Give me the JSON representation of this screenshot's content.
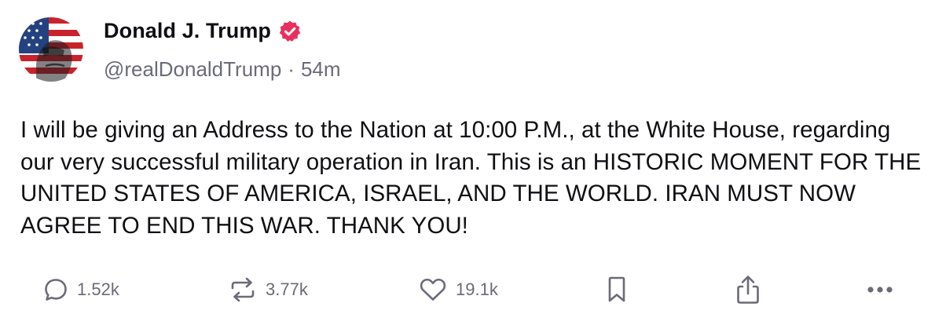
{
  "author": {
    "display_name": "Donald J. Trump",
    "handle": "@realDonaldTrump",
    "separator": "·",
    "time_ago": "54m",
    "verified": true,
    "avatar": "avatar-flag-portrait"
  },
  "post": {
    "text": "I will be giving an Address to the Nation at 10:00 P.M., at the White House, regarding our very successful military operation in Iran. This is an HISTORIC MOMENT FOR THE UNITED STATES OF AMERICA, ISRAEL, AND THE WORLD. IRAN MUST NOW AGREE TO END THIS WAR. THANK YOU!"
  },
  "actions": {
    "reply": {
      "icon": "reply-icon",
      "count": "1.52k"
    },
    "retruth": {
      "icon": "retruth-icon",
      "count": "3.77k"
    },
    "like": {
      "icon": "heart-icon",
      "count": "19.1k"
    },
    "bookmark": {
      "icon": "bookmark-icon"
    },
    "share": {
      "icon": "share-icon"
    },
    "more": {
      "icon": "more-icon"
    }
  },
  "colors": {
    "text": "#0f0f14",
    "muted": "#6b6b78",
    "verified_badge": "#e8305f",
    "background": "#ffffff"
  }
}
